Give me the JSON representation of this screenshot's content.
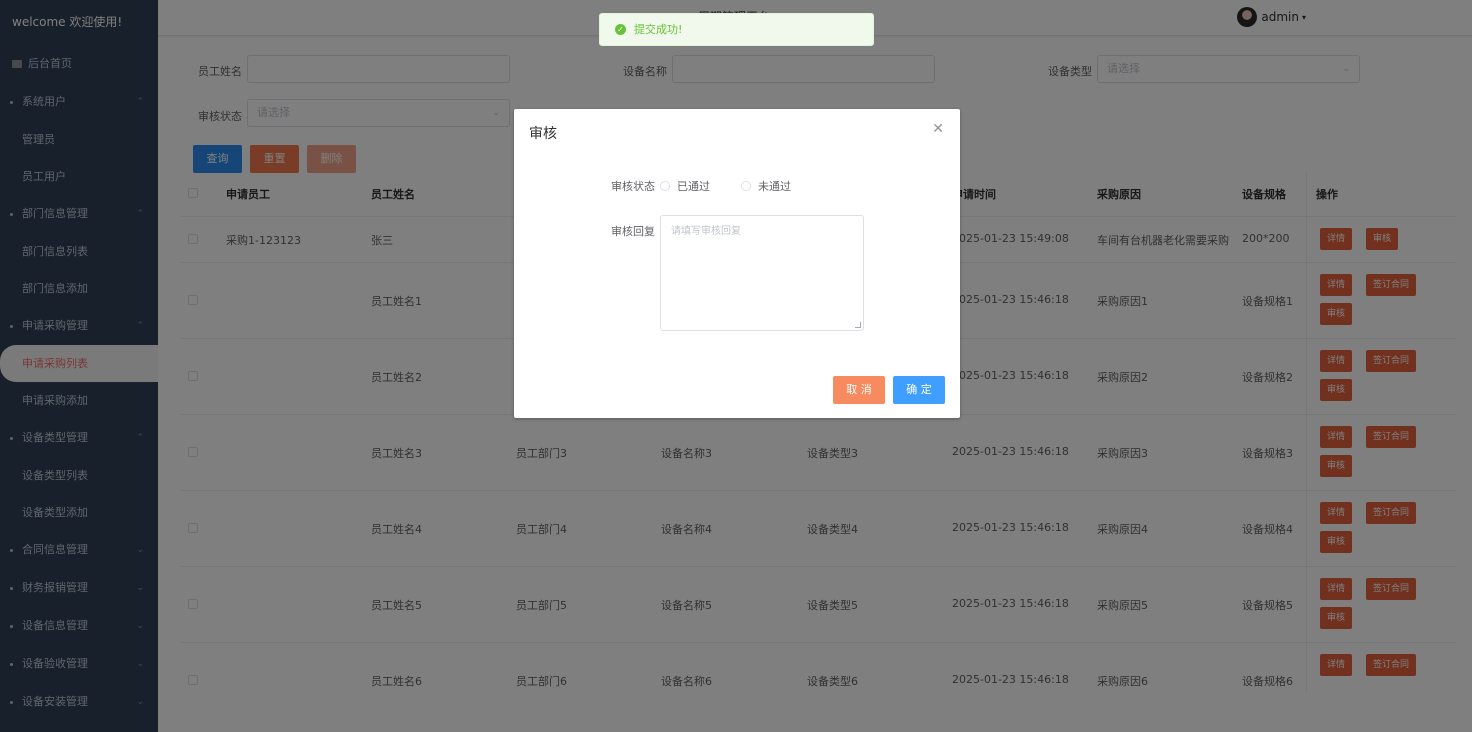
{
  "sidebar": {
    "welcome": "welcome 欢迎使用!",
    "home": "后台首页",
    "groups": [
      {
        "label": "系统用户",
        "open": true,
        "items": [
          "管理员",
          "员工用户"
        ]
      },
      {
        "label": "部门信息管理",
        "open": true,
        "items": [
          "部门信息列表",
          "部门信息添加"
        ]
      },
      {
        "label": "申请采购管理",
        "open": true,
        "items": [
          "申请采购列表",
          "申请采购添加"
        ]
      },
      {
        "label": "设备类型管理",
        "open": true,
        "items": [
          "设备类型列表",
          "设备类型添加"
        ]
      },
      {
        "label": "合同信息管理",
        "open": false,
        "items": []
      },
      {
        "label": "财务报销管理",
        "open": false,
        "items": []
      },
      {
        "label": "设备信息管理",
        "open": false,
        "items": []
      },
      {
        "label": "设备验收管理",
        "open": false,
        "items": []
      },
      {
        "label": "设备安装管理",
        "open": false,
        "items": []
      }
    ],
    "active_item": "申请采购列表"
  },
  "topbar": {
    "title": "周期管理平台",
    "user": "admin"
  },
  "search": {
    "employee_name_label": "员工姓名",
    "device_name_label": "设备名称",
    "device_type_label": "设备类型",
    "device_type_placeholder": "请选择",
    "audit_status_label": "审核状态",
    "audit_status_placeholder": "请选择",
    "query_btn": "查询",
    "reset_btn": "重置",
    "delete_btn": "删除"
  },
  "table": {
    "headers": {
      "applicant": "申请员工",
      "employee_name": "员工姓名",
      "apply_time": "申请时间",
      "reason": "采购原因",
      "spec": "设备规格",
      "ops": "操作"
    },
    "rows": [
      {
        "applicant": "采购1-123123",
        "name": "张三",
        "dept": "",
        "device": "",
        "type": "",
        "time": "2025-01-23 15:49:08",
        "reason": "车间有台机器老化需要采购",
        "spec": "200*200",
        "ops": [
          "详情",
          "审核"
        ]
      },
      {
        "applicant": "",
        "name": "员工姓名1",
        "dept": "",
        "device": "",
        "type": "",
        "time": "2025-01-23 15:46:18",
        "reason": "采购原因1",
        "spec": "设备规格1",
        "ops": [
          "详情",
          "签订合同",
          "审核"
        ]
      },
      {
        "applicant": "",
        "name": "员工姓名2",
        "dept": "",
        "device": "",
        "type": "",
        "time": "2025-01-23 15:46:18",
        "reason": "采购原因2",
        "spec": "设备规格2",
        "ops": [
          "详情",
          "签订合同",
          "审核"
        ]
      },
      {
        "applicant": "",
        "name": "员工姓名3",
        "dept": "员工部门3",
        "device": "设备名称3",
        "type": "设备类型3",
        "time": "2025-01-23 15:46:18",
        "reason": "采购原因3",
        "spec": "设备规格3",
        "ops": [
          "详情",
          "签订合同",
          "审核"
        ]
      },
      {
        "applicant": "",
        "name": "员工姓名4",
        "dept": "员工部门4",
        "device": "设备名称4",
        "type": "设备类型4",
        "time": "2025-01-23 15:46:18",
        "reason": "采购原因4",
        "spec": "设备规格4",
        "ops": [
          "详情",
          "签订合同",
          "审核"
        ]
      },
      {
        "applicant": "",
        "name": "员工姓名5",
        "dept": "员工部门5",
        "device": "设备名称5",
        "type": "设备类型5",
        "time": "2025-01-23 15:46:18",
        "reason": "采购原因5",
        "spec": "设备规格5",
        "ops": [
          "详情",
          "签订合同",
          "审核"
        ]
      },
      {
        "applicant": "",
        "name": "员工姓名6",
        "dept": "员工部门6",
        "device": "设备名称6",
        "type": "设备类型6",
        "time": "2025-01-23 15:46:18",
        "reason": "采购原因6",
        "spec": "设备规格6",
        "ops": [
          "详情",
          "签订合同"
        ]
      }
    ]
  },
  "toast": {
    "text": "提交成功!",
    "icon": "check-circle-icon"
  },
  "dialog": {
    "title": "审核",
    "status_label": "审核状态",
    "option_pass": "已通过",
    "option_fail": "未通过",
    "reply_label": "审核回复",
    "reply_placeholder": "请填写审核回复",
    "cancel": "取 消",
    "confirm": "确 定"
  },
  "colors": {
    "sidebar_bg": "#304156",
    "primary": "#409eff",
    "danger": "#e5613f",
    "success": "#67c23a"
  }
}
